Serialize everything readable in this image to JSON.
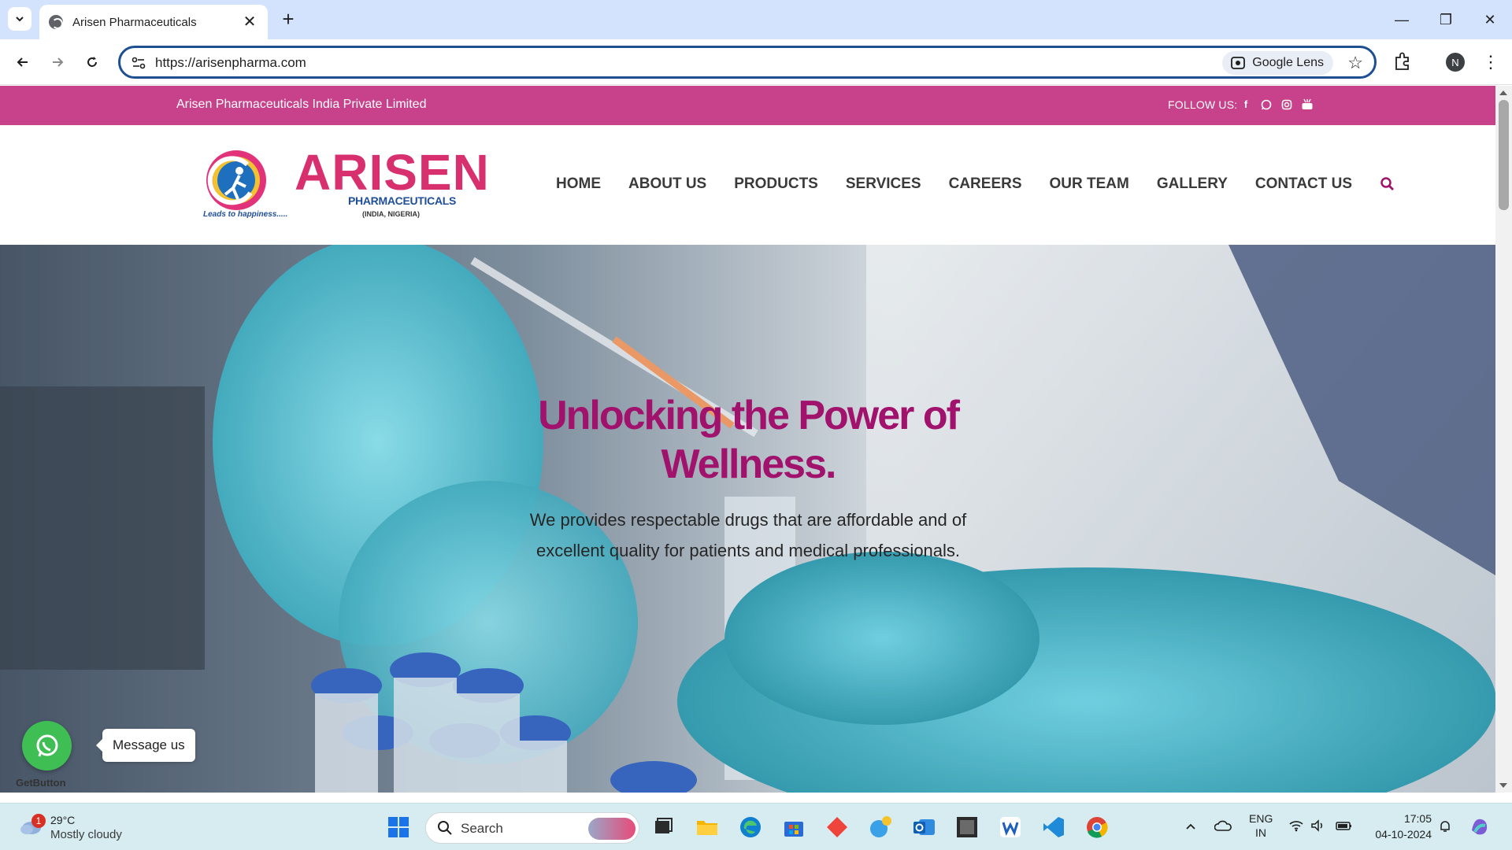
{
  "browser": {
    "tab_title": "Arisen Pharmaceuticals",
    "url": "https://arisenpharma.com",
    "lens_label": "Google Lens",
    "profile_initial": "N"
  },
  "site": {
    "topbar_company": "Arisen Pharmaceuticals India Private Limited",
    "follow_label": "FOLLOW US:",
    "social_icons": [
      "facebook-icon",
      "whatsapp-icon",
      "instagram-icon",
      "youtube-icon"
    ],
    "logo": {
      "brand": "ARISEN",
      "sub": "PHARMACEUTICALS",
      "region": "(INDIA, NIGERIA)",
      "tagline": "Leads to happiness....."
    },
    "nav": [
      "HOME",
      "ABOUT US",
      "PRODUCTS",
      "SERVICES",
      "CAREERS",
      "OUR TEAM",
      "GALLERY",
      "CONTACT US"
    ],
    "hero": {
      "title": "Unlocking the Power of Wellness.",
      "text": "We provides respectable drugs that are affordable and of excellent quality for patients and medical professionals."
    },
    "whatsapp": {
      "label": "Message us",
      "brand": "GetButton"
    }
  },
  "colors": {
    "topbar": "#c8418b",
    "brand": "#d8306f",
    "hero_title": "#a0126c",
    "nav_text": "#3a3a3a"
  },
  "taskbar": {
    "weather_temp": "29°C",
    "weather_desc": "Mostly cloudy",
    "weather_badge": "1",
    "search_label": "Search",
    "lang_top": "ENG",
    "lang_bottom": "IN",
    "time": "17:05",
    "date": "04-10-2024"
  }
}
